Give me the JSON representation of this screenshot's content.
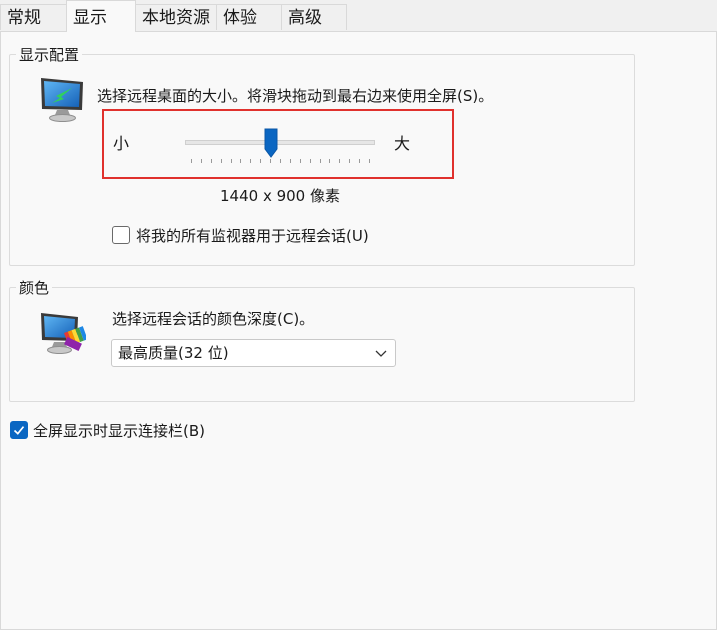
{
  "tabs": [
    {
      "label": "常规"
    },
    {
      "label": "显示",
      "active": true
    },
    {
      "label": "本地资源"
    },
    {
      "label": "体验"
    },
    {
      "label": "高级"
    }
  ],
  "display_config": {
    "group_label": "显示配置",
    "description": "选择远程桌面的大小。将滑块拖动到最右边来使用全屏(S)。",
    "slider": {
      "min_label": "小",
      "max_label": "大",
      "value_fraction": 0.45
    },
    "resolution_text": "1440 x 900 像素",
    "multi_monitor": {
      "label": "将我的所有监视器用于远程会话(U)",
      "checked": false
    }
  },
  "colors": {
    "group_label": "颜色",
    "description": "选择远程会话的颜色深度(C)。",
    "depth_select": {
      "value": "最高质量(32 位)"
    }
  },
  "fullscreen_bar": {
    "label": "全屏显示时显示连接栏(B)",
    "checked": true
  },
  "theme": {
    "accent": "#0a66c2",
    "highlight_border": "#e0312d"
  },
  "icons": {
    "monitor": "monitor-icon",
    "color_palette": "monitor-color-palette-icon",
    "chevron": "chevron-down-icon",
    "check": "check-icon"
  }
}
